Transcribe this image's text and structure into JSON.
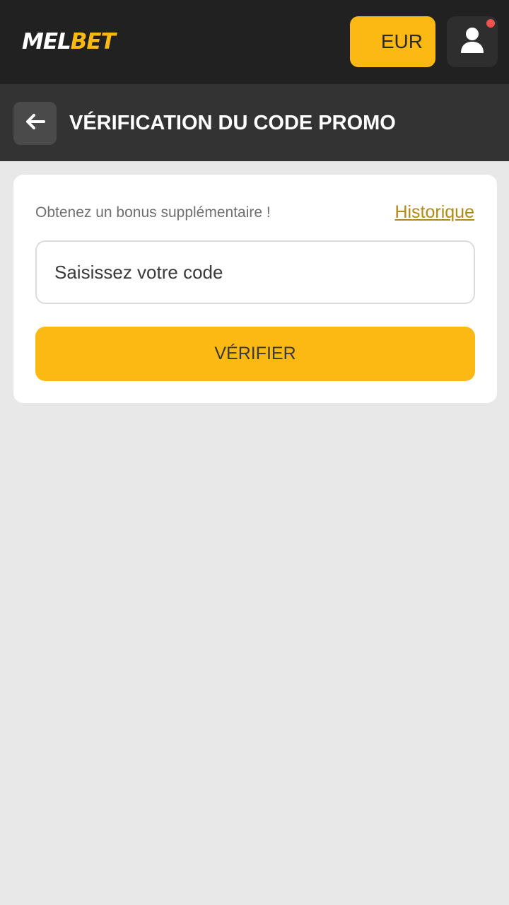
{
  "header": {
    "logo": {
      "part1": "MEL",
      "part2": "BET"
    },
    "currency_label": "EUR",
    "user_icon": "user-icon",
    "notification_color": "#ef5350"
  },
  "subheader": {
    "back_icon": "arrow-left-icon",
    "title": "VÉRIFICATION DU CODE PROMO"
  },
  "promo": {
    "bonus_text": "Obtenez un bonus supplémentaire !",
    "history_link": "Historique",
    "code_placeholder": "Saisissez votre code",
    "verify_label": "VÉRIFIER"
  },
  "colors": {
    "accent": "#fdb913",
    "topbar": "#212121",
    "subheader": "#333333",
    "background": "#e8e8e8",
    "link": "#b08a13"
  }
}
